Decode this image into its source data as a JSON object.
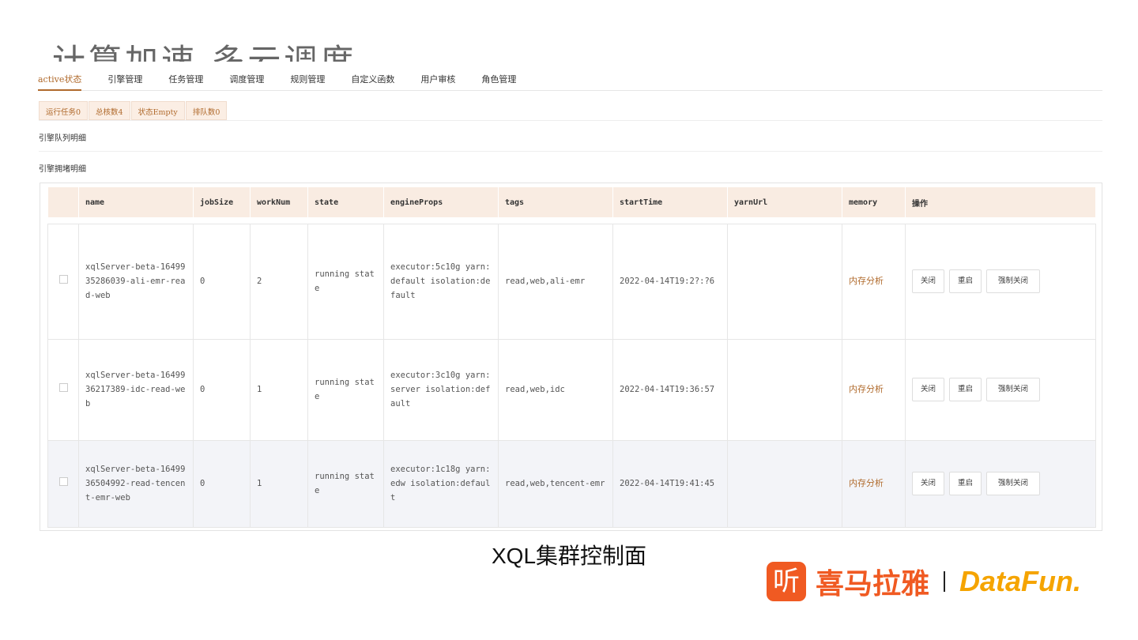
{
  "slide_title": "计算加速 多云调度",
  "tabs": [
    "active状态",
    "引擎管理",
    "任务管理",
    "调度管理",
    "规则管理",
    "自定义函数",
    "用户审核",
    "角色管理"
  ],
  "badges": [
    "运行任务0",
    "总核数4",
    "状态Empty",
    "排队数0"
  ],
  "sections": {
    "queue": "引擎队列明细",
    "blocked": "引擎拥堵明细"
  },
  "columns": [
    "name",
    "jobSize",
    "workNum",
    "state",
    "engineProps",
    "tags",
    "startTime",
    "yarnUrl",
    "memory",
    "操作"
  ],
  "rows": [
    {
      "name": "xqlServer-beta-1649935286039-ali-emr-read-web",
      "jobSize": "0",
      "workNum": "2",
      "state": "running state",
      "engineProps": "executor:5c10g yarn:default isolation:default",
      "tags": "read,web,ali-emr",
      "startTime": "2022-04-14T19:2?:?6",
      "memory": "内存分析"
    },
    {
      "name": "xqlServer-beta-1649936217389-idc-read-web",
      "jobSize": "0",
      "workNum": "1",
      "state": "running state",
      "engineProps": "executor:3c10g yarn:server isolation:default",
      "tags": "read,web,idc",
      "startTime": "2022-04-14T19:36:57",
      "memory": "内存分析"
    },
    {
      "name": "xqlServer-beta-1649936504992-read-tencent-emr-web",
      "jobSize": "0",
      "workNum": "1",
      "state": "running state",
      "engineProps": "executor:1c18g yarn:edw isolation:default",
      "tags": "read,web,tencent-emr",
      "startTime": "2022-04-14T19:41:45",
      "memory": "内存分析"
    }
  ],
  "actions": {
    "close": "关闭",
    "restart": "重启",
    "force_close": "强制关闭"
  },
  "caption": "XQL集群控制面",
  "logos": {
    "ximalaya_icon": "听",
    "ximalaya": "喜马拉雅",
    "datafun": "DataFun."
  },
  "colors": {
    "accent": "#b06a2c",
    "header_bg": "#f9ece2",
    "logo_red": "#f05a22",
    "logo_yellow": "#f5a400"
  }
}
